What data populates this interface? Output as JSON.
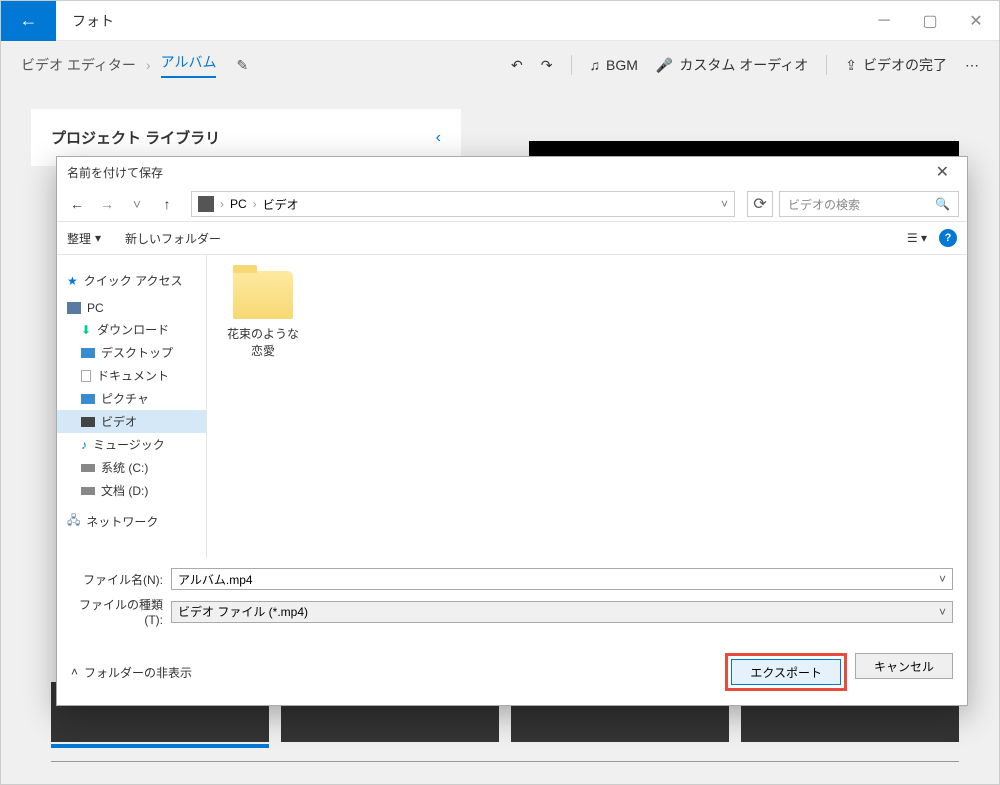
{
  "app": {
    "title": "フォト"
  },
  "breadcrumb": {
    "editor": "ビデオ エディター",
    "album": "アルバム"
  },
  "toolbar": {
    "bgm": "BGM",
    "custom_audio": "カスタム オーディオ",
    "finish_video": "ビデオの完了"
  },
  "panel": {
    "title": "プロジェクト ライブラリ"
  },
  "dialog": {
    "title": "名前を付けて保存",
    "path": {
      "pc": "PC",
      "folder": "ビデオ"
    },
    "search_placeholder": "ビデオの検索",
    "organize": "整理",
    "new_folder": "新しいフォルダー",
    "tree": {
      "quick_access": "クイック アクセス",
      "pc": "PC",
      "downloads": "ダウンロード",
      "desktop": "デスクトップ",
      "documents": "ドキュメント",
      "pictures": "ピクチャ",
      "videos": "ビデオ",
      "music": "ミュージック",
      "drive_c": "系统 (C:)",
      "drive_d": "文档 (D:)",
      "network": "ネットワーク"
    },
    "folder_name": "花束のような恋愛",
    "filename_label": "ファイル名(N):",
    "filename_value": "アルバム.mp4",
    "filetype_label": "ファイルの種類(T):",
    "filetype_value": "ビデオ ファイル (*.mp4)",
    "hide_folders": "フォルダーの非表示",
    "export_btn": "エクスポート",
    "cancel_btn": "キャンセル"
  }
}
